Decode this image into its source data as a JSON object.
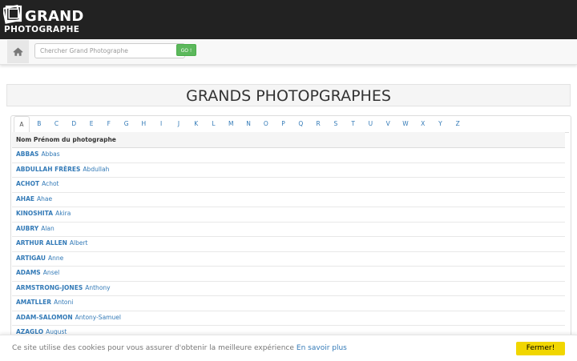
{
  "logo": {
    "line1": "GRAND",
    "line2": "PHOTOGRAPHE"
  },
  "search": {
    "placeholder": "Chercher Grand Photographe",
    "value": "",
    "button_label": "GO !"
  },
  "page_title": "GRANDS PHOTOPGRAPHES",
  "alphabet": [
    "A",
    "B",
    "C",
    "D",
    "E",
    "F",
    "G",
    "H",
    "I",
    "J",
    "K",
    "L",
    "M",
    "N",
    "O",
    "P",
    "Q",
    "R",
    "S",
    "T",
    "U",
    "V",
    "W",
    "X",
    "Y",
    "Z"
  ],
  "active_letter": "A",
  "table": {
    "header": "Nom Prénom du photographe",
    "rows": [
      {
        "nom": "ABBAS",
        "prenom": "Abbas"
      },
      {
        "nom": "ABDULLAH FRÈRES",
        "prenom": "Abdullah"
      },
      {
        "nom": "ACHOT",
        "prenom": "Achot"
      },
      {
        "nom": "AHAE",
        "prenom": "Ahae"
      },
      {
        "nom": "KINOSHITA",
        "prenom": "Akira"
      },
      {
        "nom": "AUBRY",
        "prenom": "Alan"
      },
      {
        "nom": "ARTHUR ALLEN",
        "prenom": "Albert"
      },
      {
        "nom": "ARTIGAU",
        "prenom": "Anne"
      },
      {
        "nom": "ADAMS",
        "prenom": "Ansel"
      },
      {
        "nom": "ARMSTRONG-JONES",
        "prenom": "Anthony"
      },
      {
        "nom": "AMATLLER",
        "prenom": "Antoni"
      },
      {
        "nom": "ADAM-SALOMON",
        "prenom": "Antony-Samuel"
      },
      {
        "nom": "AZAGLO",
        "prenom": "August"
      }
    ]
  },
  "cookie": {
    "text": "Ce site utilise des cookies pour vous assurer d'obtenir la meilleure expérience",
    "link": "En savoir plus",
    "button": "Fermer!"
  },
  "colors": {
    "header_bg": "#222222",
    "link": "#337ab7",
    "go_button": "#5cb85c",
    "cookie_button": "#f1d600"
  },
  "icons": {
    "logo": "stacked-photos-icon",
    "home": "home-icon"
  }
}
